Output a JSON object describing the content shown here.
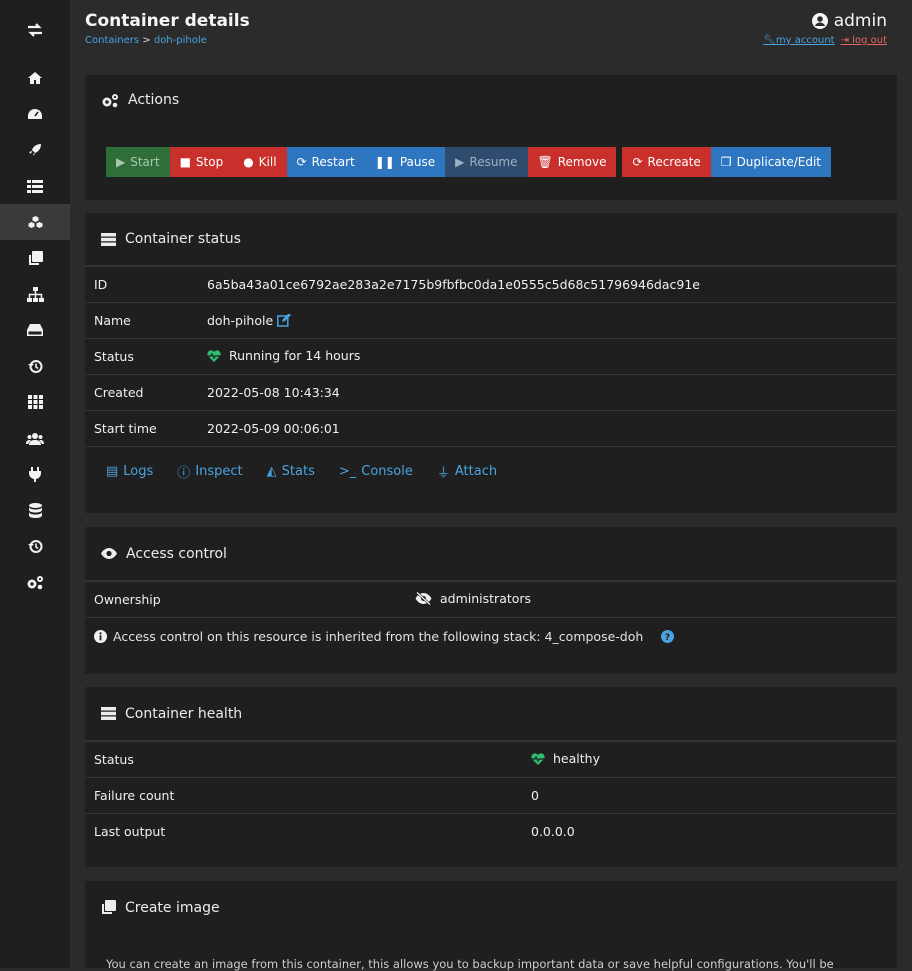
{
  "sidebar": {
    "items": [
      {
        "icon": "exchange-icon"
      },
      {
        "icon": "home-icon"
      },
      {
        "icon": "dashboard-icon"
      },
      {
        "icon": "rocket-icon"
      },
      {
        "icon": "list-icon"
      },
      {
        "icon": "cubes-icon",
        "active": true
      },
      {
        "icon": "clone-icon"
      },
      {
        "icon": "sitemap-icon"
      },
      {
        "icon": "hdd-icon"
      },
      {
        "icon": "history-icon"
      },
      {
        "icon": "grid-icon"
      },
      {
        "icon": "users-icon"
      },
      {
        "icon": "plug-icon"
      },
      {
        "icon": "database-icon"
      },
      {
        "icon": "history-icon"
      },
      {
        "icon": "cogs-icon"
      }
    ]
  },
  "header": {
    "title": "Container details",
    "breadcrumb": {
      "parent": "Containers",
      "sep": ">",
      "current": "doh-pihole"
    },
    "user": {
      "name": "admin",
      "my_account": "my account",
      "log_out": "log out"
    }
  },
  "actions": {
    "title": "Actions",
    "buttons": {
      "start": "Start",
      "stop": "Stop",
      "kill": "Kill",
      "restart": "Restart",
      "pause": "Pause",
      "resume": "Resume",
      "remove": "Remove",
      "recreate": "Recreate",
      "duplicate": "Duplicate/Edit"
    }
  },
  "status": {
    "title": "Container status",
    "rows": {
      "id": {
        "label": "ID",
        "value": "6a5ba43a01ce6792ae283a2e7175b9fbfbc0da1e0555c5d68c51796946dac91e"
      },
      "name": {
        "label": "Name",
        "value": "doh-pihole"
      },
      "status": {
        "label": "Status",
        "value": "Running for 14 hours"
      },
      "created": {
        "label": "Created",
        "value": "2022-05-08 10:43:34"
      },
      "start_time": {
        "label": "Start time",
        "value": "2022-05-09 00:06:01"
      }
    },
    "links": {
      "logs": "Logs",
      "inspect": "Inspect",
      "stats": "Stats",
      "console": "Console",
      "attach": "Attach"
    }
  },
  "access": {
    "title": "Access control",
    "ownership_label": "Ownership",
    "ownership_value": "administrators",
    "note": "Access control on this resource is inherited from the following stack: 4_compose-doh"
  },
  "health": {
    "title": "Container health",
    "rows": {
      "status": {
        "label": "Status",
        "value": "healthy"
      },
      "failure": {
        "label": "Failure count",
        "value": "0"
      },
      "output": {
        "label": "Last output",
        "value": "0.0.0.0"
      }
    }
  },
  "create_image": {
    "title": "Create image",
    "text": "You can create an image from this container, this allows you to backup important data or save helpful configurations. You'll be"
  },
  "colors": {
    "link": "#4aa3df",
    "danger": "#c9302c",
    "primary": "#2f76c1",
    "success": "#2f6e39",
    "heart": "#2fbf71"
  }
}
